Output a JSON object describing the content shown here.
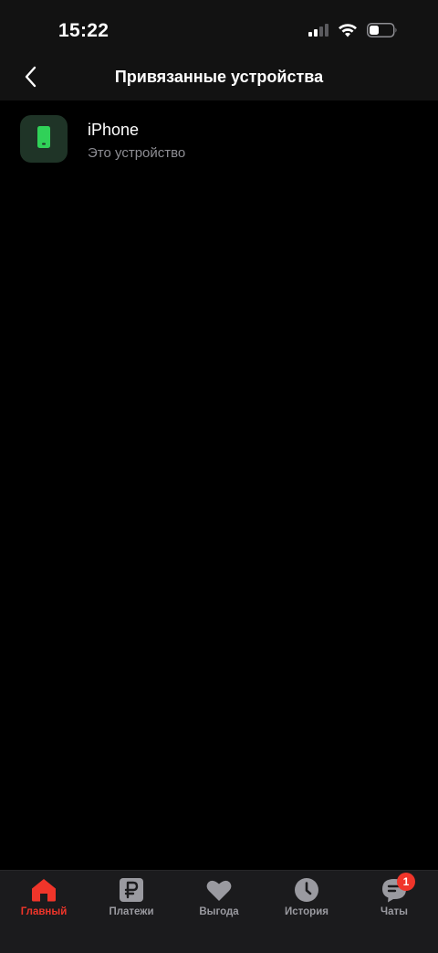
{
  "status_bar": {
    "time": "15:22",
    "icons": [
      "cellular-signal-icon",
      "wifi-icon",
      "battery-icon"
    ]
  },
  "nav": {
    "title": "Привязанные устройства",
    "back_icon": "chevron-left-icon"
  },
  "devices": [
    {
      "name": "iPhone",
      "subtitle": "Это устройство",
      "icon": "smartphone-icon",
      "icon_color": "#30d158"
    }
  ],
  "tabs": [
    {
      "label": "Главный",
      "icon": "home-icon",
      "active": true
    },
    {
      "label": "Платежи",
      "icon": "ruble-icon",
      "active": false
    },
    {
      "label": "Выгода",
      "icon": "heart-icon",
      "active": false
    },
    {
      "label": "История",
      "icon": "clock-icon",
      "active": false
    },
    {
      "label": "Чаты",
      "icon": "chat-icon",
      "active": false,
      "badge": "1"
    }
  ],
  "colors": {
    "accent": "#f0352a",
    "inactive": "#9a9aa0",
    "background": "#000000",
    "bar_background": "#1b1b1d"
  }
}
